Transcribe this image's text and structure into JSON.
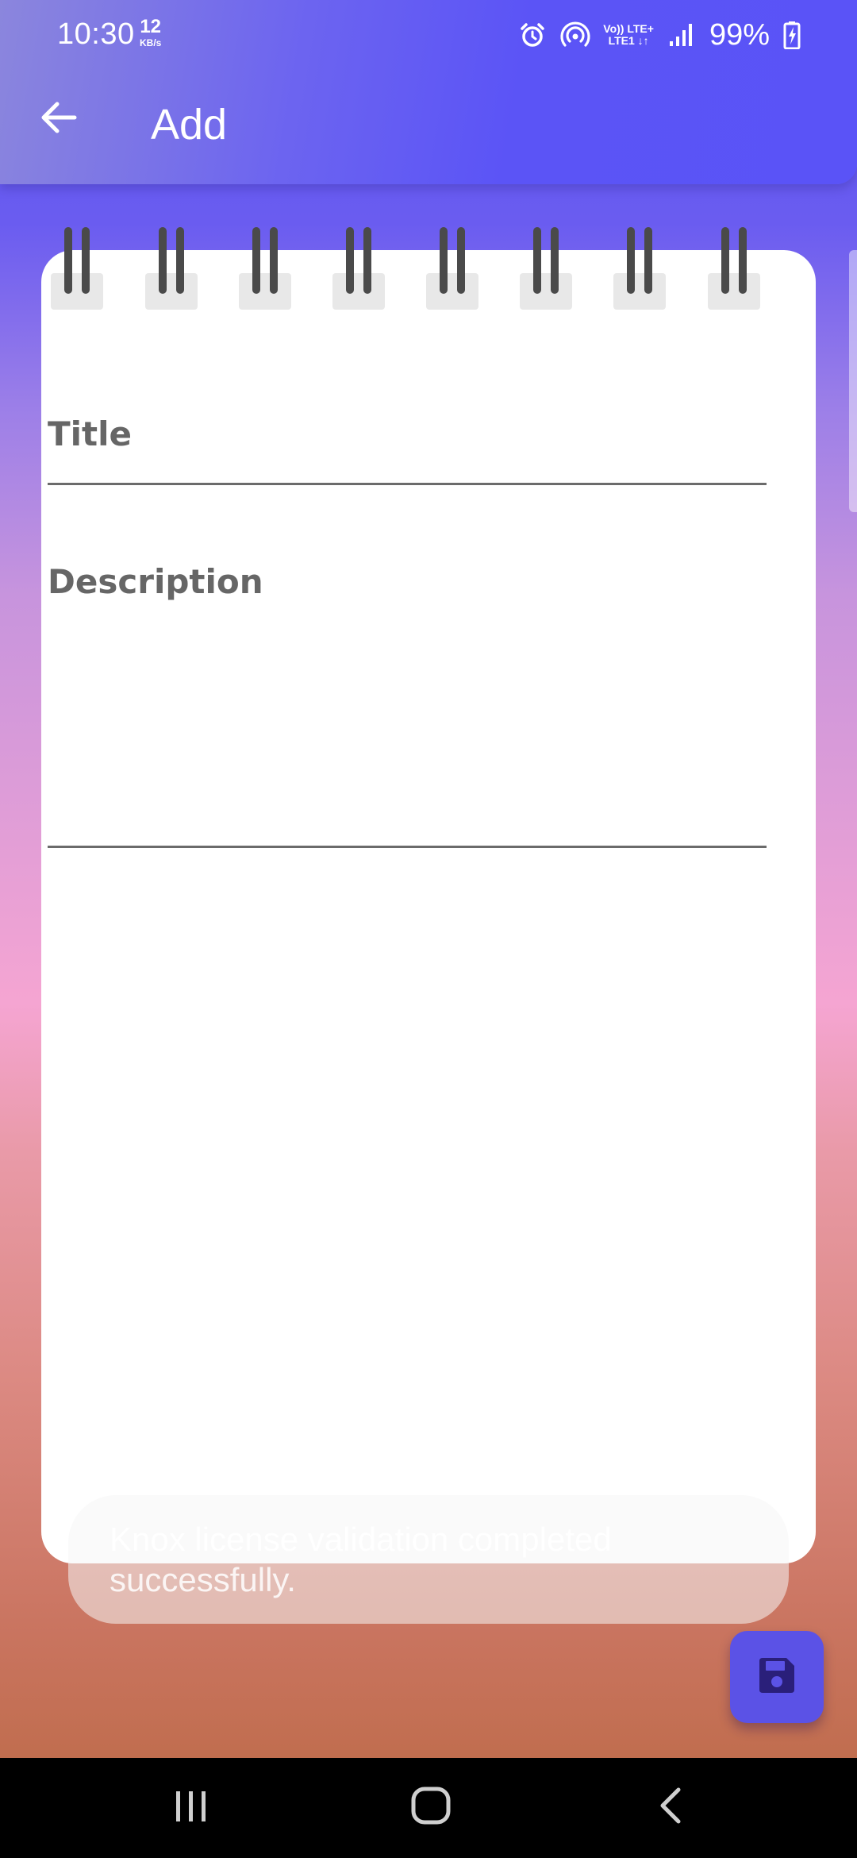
{
  "status_bar": {
    "time": "10:30",
    "net_speed_value": "12",
    "net_speed_unit": "KB/s",
    "network_line1": "Vo)) LTE+",
    "network_line2": "LTE1 ↓↑",
    "battery": "99%"
  },
  "app_bar": {
    "title": "Add",
    "back_icon": "arrow-left-icon"
  },
  "form": {
    "title_label": "Title",
    "description_label": "Description",
    "title_value": "",
    "description_value": ""
  },
  "toast": {
    "message": "Knox license validation completed successfully."
  },
  "fab": {
    "icon": "save-icon"
  },
  "colors": {
    "app_bar": "#5a53f7",
    "fab": "#5b52e6",
    "fab_icon": "#2a1f7a",
    "ring": "#4a4a4a"
  }
}
